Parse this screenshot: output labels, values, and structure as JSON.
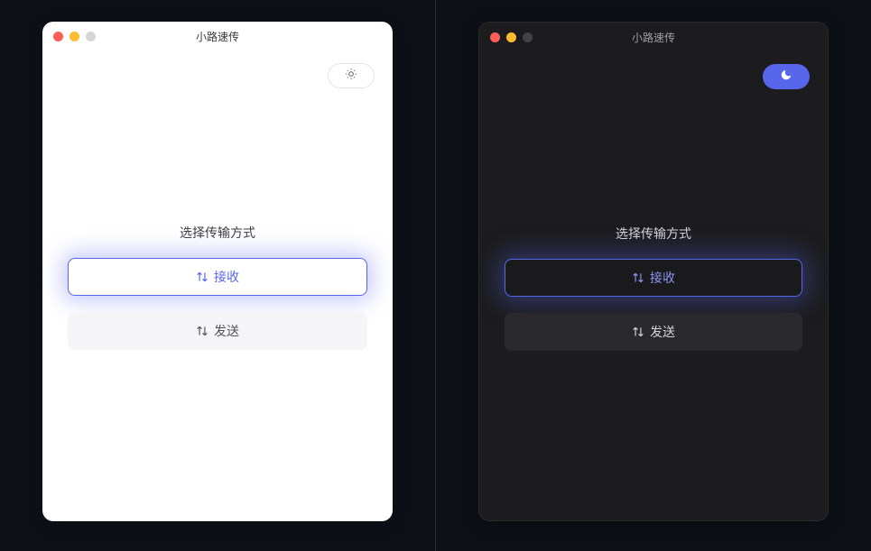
{
  "app_title": "小路速传",
  "heading": "选择传输方式",
  "buttons": {
    "receive": "接收",
    "send": "发送"
  },
  "icons": {
    "sun": "sun-icon",
    "moon": "moon-icon",
    "swap": "swap-icon"
  },
  "colors": {
    "accent": "#5866eb",
    "light_bg": "#ffffff",
    "dark_bg": "#1c1c1e",
    "secondary_light": "#f5f5f7",
    "secondary_dark": "#2a2a2c"
  }
}
